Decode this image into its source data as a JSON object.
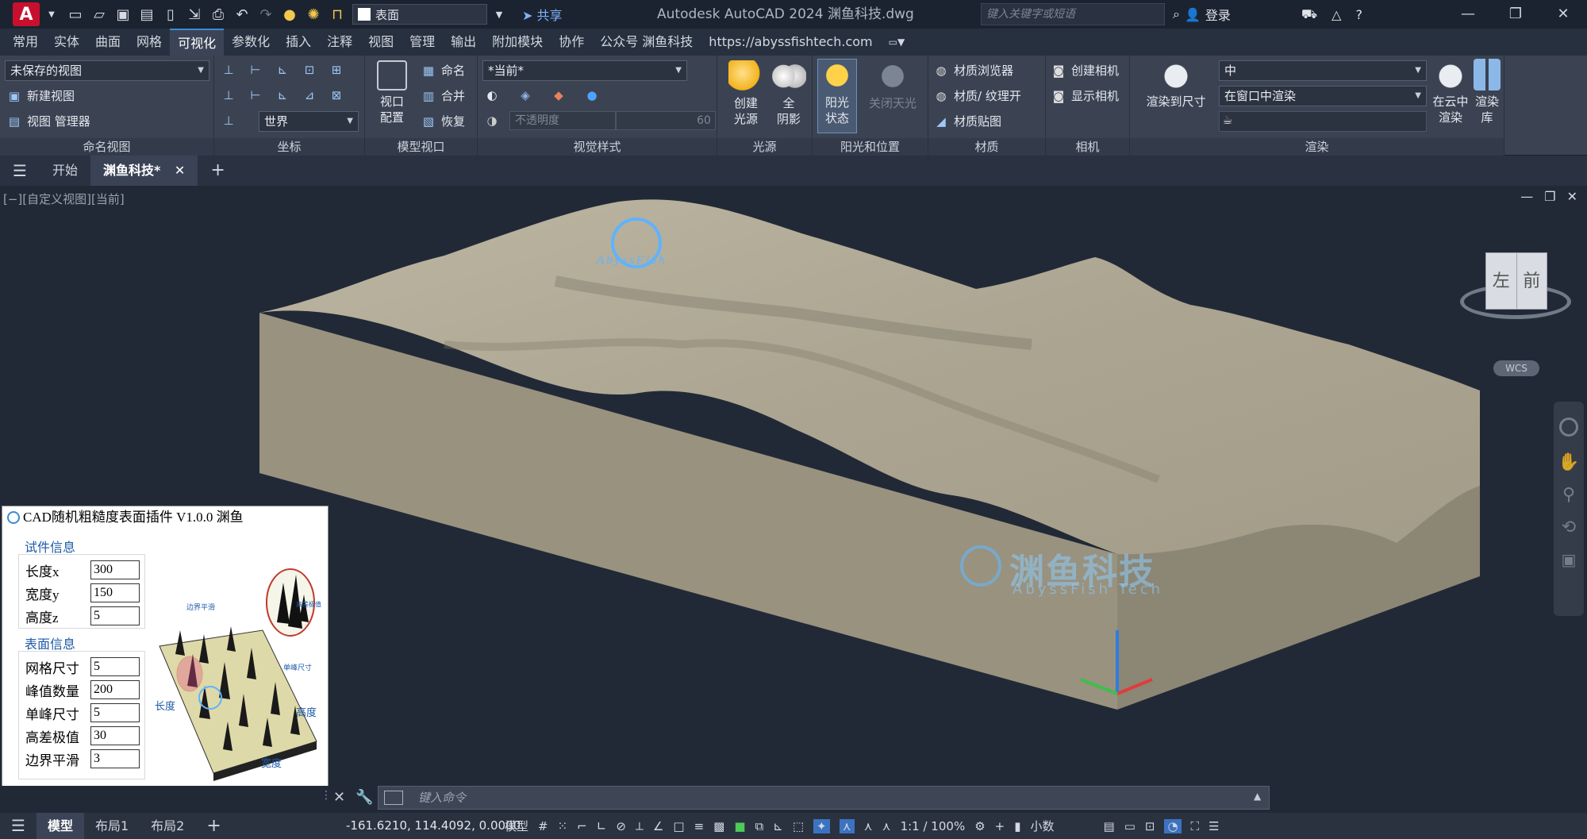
{
  "titlebar": {
    "app_logo": "A",
    "layer": "表面",
    "share": "共享",
    "title": "Autodesk AutoCAD 2024    渊鱼科技.dwg",
    "search_placeholder": "键入关键字或短语",
    "login": "登录"
  },
  "menu_tabs": [
    "常用",
    "实体",
    "曲面",
    "网格",
    "可视化",
    "参数化",
    "插入",
    "注释",
    "视图",
    "管理",
    "输出",
    "附加模块",
    "协作",
    "公众号 渊鱼科技",
    "https://abyssfishtech.com"
  ],
  "ribbon": {
    "named_views": {
      "dropdown": "未保存的视图",
      "new_view": "新建视图",
      "view_manager": "视图 管理器",
      "label": "命名视图"
    },
    "coordinates": {
      "world": "世界",
      "label": "坐标"
    },
    "model_viewports": {
      "viewport_config": "视口\n配置",
      "name": "命名",
      "merge": "合并",
      "restore": "恢复",
      "label": "模型视口"
    },
    "visual_styles": {
      "current": "*当前*",
      "opacity_placeholder": "不透明度",
      "opacity_value": "60",
      "label": "视觉样式"
    },
    "lights": {
      "create_light": "创建\n光源",
      "shadow": "全\n阴影",
      "label": "光源"
    },
    "sun": {
      "sun_status": "阳光\n状态",
      "skyoff": "关闭天光",
      "label": "阳光和位置"
    },
    "materials": {
      "browser": "材质浏览器",
      "texture": "材质/ 纹理开",
      "mapping": "材质贴图",
      "label": "材质"
    },
    "camera": {
      "create": "创建相机",
      "show": "显示相机",
      "label": "相机"
    },
    "render": {
      "render_to_size": "渲染到尺寸",
      "quality": "中",
      "mode": "在窗口中渲染",
      "cloud": "在云中\n渲染",
      "library": "渲染\n库",
      "label": "渲染"
    }
  },
  "doc_tabs": [
    "开始",
    "渊鱼科技*"
  ],
  "viewport": {
    "label": "[−][自定义视图][当前]",
    "viewcube_left": "左",
    "viewcube_front": "前",
    "wcs": "WCS",
    "watermark_cn": "渊鱼科技",
    "watermark_en": "AbyssFish Tech",
    "logo_text": "AbyssFish"
  },
  "plugin": {
    "title": "CAD随机粗糙度表面插件 V1.0.0 渊鱼",
    "section1": "试件信息",
    "fields1": [
      {
        "label": "长度x",
        "value": "300"
      },
      {
        "label": "宽度y",
        "value": "150"
      },
      {
        "label": "高度z",
        "value": "5"
      }
    ],
    "section2": "表面信息",
    "fields2": [
      {
        "label": "网格尺寸",
        "value": "5"
      },
      {
        "label": "峰值数量",
        "value": "200"
      },
      {
        "label": "单峰尺寸",
        "value": "5"
      },
      {
        "label": "高差极值",
        "value": "30"
      },
      {
        "label": "边界平滑",
        "value": "3"
      }
    ],
    "illus_length": "长度",
    "illus_width": "宽度",
    "illus_height": "高度",
    "illus_edge": "边界平滑",
    "illus_diff": "高差极值",
    "illus_peak": "单峰尺寸"
  },
  "cmdline": {
    "placeholder": "键入命令"
  },
  "statusbar": {
    "tabs": [
      "模型",
      "布局1",
      "布局2"
    ],
    "coords": "-161.6210, 114.4092, 0.0000",
    "mode": "模型",
    "scale": "1:1 / 100%",
    "units": "小数"
  },
  "colors": {
    "accent": "#3d8bd9",
    "terrain": "#b4ad97",
    "background": "#222936"
  }
}
